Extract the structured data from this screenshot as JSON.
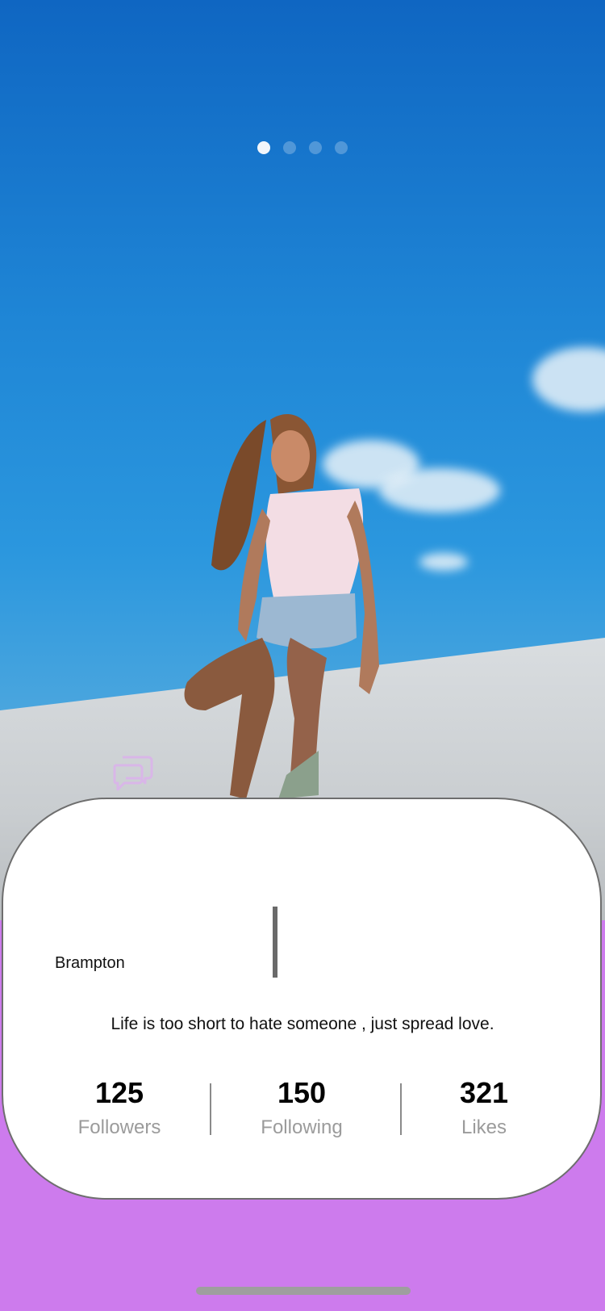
{
  "carousel": {
    "page_count": 4,
    "active_index": 0
  },
  "hero": {
    "image": "woman-sitting-on-white-wall-under-blue-sky"
  },
  "chat_button": {
    "icon": "chat-bubbles-icon"
  },
  "profile": {
    "location": "Brampton",
    "bio": "Life is too short to hate someone , just spread love."
  },
  "stats": [
    {
      "value": "125",
      "label": "Followers"
    },
    {
      "value": "150",
      "label": "Following"
    },
    {
      "value": "321",
      "label": "Likes"
    }
  ],
  "colors": {
    "background": "#cd7bed",
    "card": "#ffffff",
    "stat_label": "#9b9b9b"
  }
}
